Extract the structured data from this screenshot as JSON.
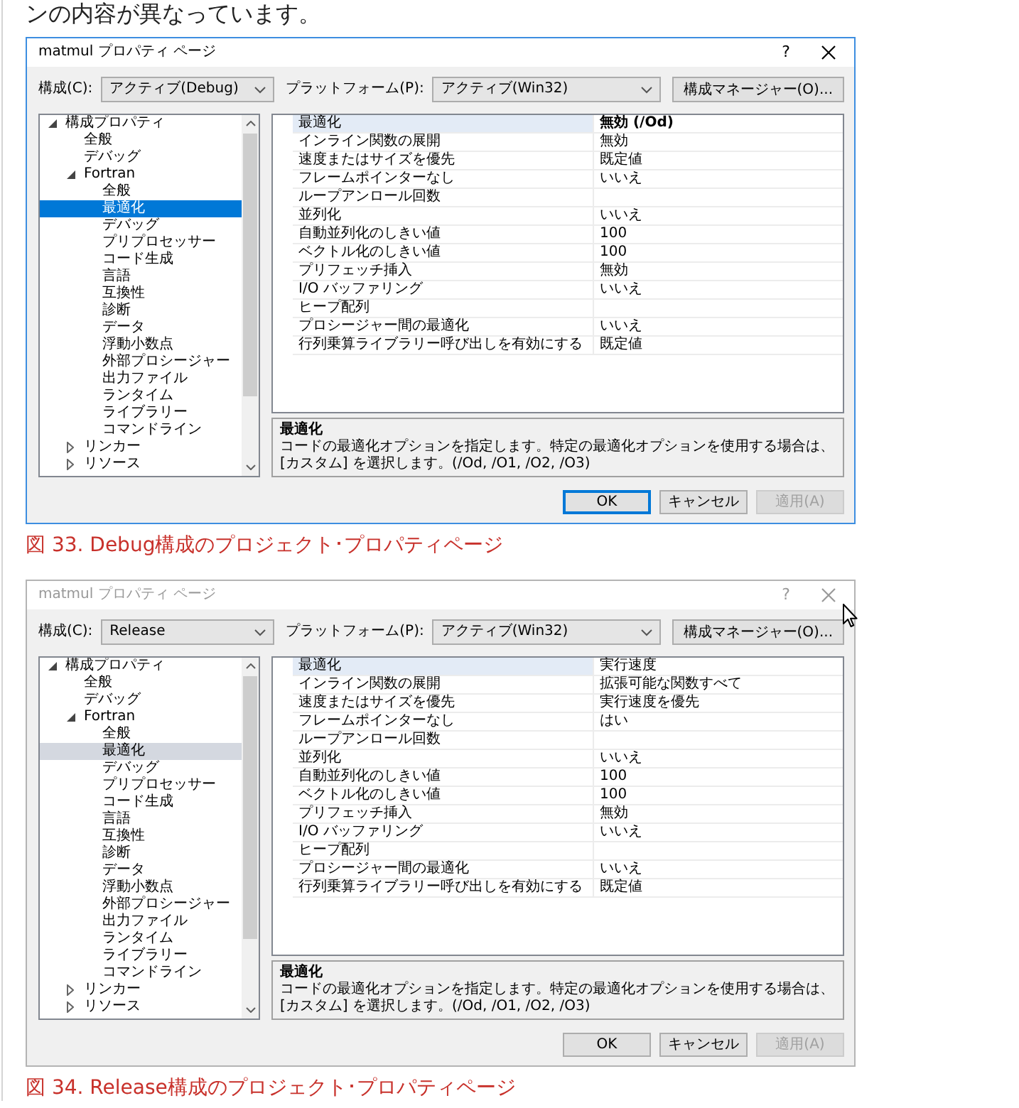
{
  "intro_text": "ンの内容が異なっています。",
  "figures": [
    {
      "dialog": {
        "active": true,
        "title": "matmul プロパティ ページ",
        "help_label": "?",
        "toolbar": {
          "config_label": "構成(C):",
          "config_value": "アクティブ(Debug)",
          "platform_label": "プラットフォーム(P):",
          "platform_value": "アクティブ(Win32)",
          "manager_button": "構成マネージャー(O)..."
        },
        "tree": [
          {
            "label": "構成プロパティ",
            "expanded": true,
            "selected": false,
            "children": [
              {
                "label": "全般",
                "selected": false
              },
              {
                "label": "デバッグ",
                "selected": false
              },
              {
                "label": "Fortran",
                "expanded": true,
                "selected": false,
                "children": [
                  {
                    "label": "全般",
                    "selected": false
                  },
                  {
                    "label": "最適化",
                    "selected": true
                  },
                  {
                    "label": "デバッグ",
                    "selected": false
                  },
                  {
                    "label": "プリプロセッサー",
                    "selected": false
                  },
                  {
                    "label": "コード生成",
                    "selected": false
                  },
                  {
                    "label": "言語",
                    "selected": false
                  },
                  {
                    "label": "互換性",
                    "selected": false
                  },
                  {
                    "label": "診断",
                    "selected": false
                  },
                  {
                    "label": "データ",
                    "selected": false
                  },
                  {
                    "label": "浮動小数点",
                    "selected": false
                  },
                  {
                    "label": "外部プロシージャー",
                    "selected": false
                  },
                  {
                    "label": "出力ファイル",
                    "selected": false
                  },
                  {
                    "label": "ランタイム",
                    "selected": false
                  },
                  {
                    "label": "ライブラリー",
                    "selected": false
                  },
                  {
                    "label": "コマンドライン",
                    "selected": false
                  }
                ]
              },
              {
                "label": "リンカー",
                "expanded": false,
                "selected": false
              },
              {
                "label": "リソース",
                "expanded": false,
                "selected": false
              }
            ]
          }
        ],
        "properties": [
          {
            "name": "最適化",
            "value": "無効 (/Od)",
            "modified": true,
            "selected": true
          },
          {
            "name": "インライン関数の展開",
            "value": "無効",
            "modified": false,
            "selected": false
          },
          {
            "name": "速度またはサイズを優先",
            "value": "既定値",
            "modified": false,
            "selected": false
          },
          {
            "name": "フレームポインターなし",
            "value": "いいえ",
            "modified": false,
            "selected": false
          },
          {
            "name": "ループアンロール回数",
            "selected": false
          },
          {
            "name": "並列化",
            "value": "いいえ",
            "modified": false,
            "selected": false
          },
          {
            "name": "自動並列化のしきい値",
            "value": "100",
            "modified": false,
            "selected": false
          },
          {
            "name": "ベクトル化のしきい値",
            "value": "100",
            "modified": false,
            "selected": false
          },
          {
            "name": "プリフェッチ挿入",
            "value": "無効",
            "modified": false,
            "selected": false
          },
          {
            "name": "I/O バッファリング",
            "value": "いいえ",
            "modified": false,
            "selected": false
          },
          {
            "name": "ヒープ配列",
            "selected": false
          },
          {
            "name": "プロシージャー間の最適化",
            "value": "いいえ",
            "modified": false,
            "selected": false
          },
          {
            "name": "行列乗算ライブラリー呼び出しを有効にする",
            "value": "既定値",
            "modified": false,
            "selected": false
          }
        ],
        "description": {
          "title": "最適化",
          "text": "コードの最適化オプションを指定します。特定の最適化オプションを使用する場合は、[カスタム] を選択します。(/Od, /O1, /O2, /O3)"
        },
        "buttons": [
          {
            "label": "OK",
            "focused": true,
            "disabled": false
          },
          {
            "label": "キャンセル",
            "focused": false,
            "disabled": false
          },
          {
            "label": "適用(A)",
            "focused": false,
            "disabled": true
          }
        ]
      },
      "caption": "図 33. Debug構成のプロジェクト･プロパティページ"
    },
    {
      "dialog": {
        "active": false,
        "mouse_pointer": true,
        "title": "matmul プロパティ ページ",
        "help_label": "?",
        "toolbar": {
          "config_label": "構成(C):",
          "config_value": "Release",
          "platform_label": "プラットフォーム(P):",
          "platform_value": "アクティブ(Win32)",
          "manager_button": "構成マネージャー(O)..."
        },
        "tree": [
          {
            "label": "構成プロパティ",
            "expanded": true,
            "selected": false,
            "children": [
              {
                "label": "全般",
                "selected": false
              },
              {
                "label": "デバッグ",
                "selected": false
              },
              {
                "label": "Fortran",
                "expanded": true,
                "selected": false,
                "children": [
                  {
                    "label": "全般",
                    "selected": false
                  },
                  {
                    "label": "最適化",
                    "selected": true
                  },
                  {
                    "label": "デバッグ",
                    "selected": false
                  },
                  {
                    "label": "プリプロセッサー",
                    "selected": false
                  },
                  {
                    "label": "コード生成",
                    "selected": false
                  },
                  {
                    "label": "言語",
                    "selected": false
                  },
                  {
                    "label": "互換性",
                    "selected": false
                  },
                  {
                    "label": "診断",
                    "selected": false
                  },
                  {
                    "label": "データ",
                    "selected": false
                  },
                  {
                    "label": "浮動小数点",
                    "selected": false
                  },
                  {
                    "label": "外部プロシージャー",
                    "selected": false
                  },
                  {
                    "label": "出力ファイル",
                    "selected": false
                  },
                  {
                    "label": "ランタイム",
                    "selected": false
                  },
                  {
                    "label": "ライブラリー",
                    "selected": false
                  },
                  {
                    "label": "コマンドライン",
                    "selected": false
                  }
                ]
              },
              {
                "label": "リンカー",
                "expanded": false,
                "selected": false
              },
              {
                "label": "リソース",
                "expanded": false,
                "selected": false
              }
            ]
          }
        ],
        "properties": [
          {
            "name": "最適化",
            "value": "実行速度",
            "modified": false,
            "selected": true
          },
          {
            "name": "インライン関数の展開",
            "value": "拡張可能な関数すべて",
            "modified": false,
            "selected": false
          },
          {
            "name": "速度またはサイズを優先",
            "value": "実行速度を優先",
            "modified": false,
            "selected": false
          },
          {
            "name": "フレームポインターなし",
            "value": "はい",
            "modified": false,
            "selected": false
          },
          {
            "name": "ループアンロール回数",
            "selected": false
          },
          {
            "name": "並列化",
            "value": "いいえ",
            "modified": false,
            "selected": false
          },
          {
            "name": "自動並列化のしきい値",
            "value": "100",
            "modified": false,
            "selected": false
          },
          {
            "name": "ベクトル化のしきい値",
            "value": "100",
            "modified": false,
            "selected": false
          },
          {
            "name": "プリフェッチ挿入",
            "value": "無効",
            "modified": false,
            "selected": false
          },
          {
            "name": "I/O バッファリング",
            "value": "いいえ",
            "modified": false,
            "selected": false
          },
          {
            "name": "ヒープ配列",
            "selected": false
          },
          {
            "name": "プロシージャー間の最適化",
            "value": "いいえ",
            "modified": false,
            "selected": false
          },
          {
            "name": "行列乗算ライブラリー呼び出しを有効にする",
            "value": "既定値",
            "modified": false,
            "selected": false
          }
        ],
        "description": {
          "title": "最適化",
          "text": "コードの最適化オプションを指定します。特定の最適化オプションを使用する場合は、[カスタム] を選択します。(/Od, /O1, /O2, /O3)"
        },
        "buttons": [
          {
            "label": "OK",
            "focused": false,
            "disabled": false
          },
          {
            "label": "キャンセル",
            "focused": false,
            "disabled": false
          },
          {
            "label": "適用(A)",
            "focused": false,
            "disabled": true
          }
        ]
      },
      "caption": "図 34. Release構成のプロジェクト･プロパティページ"
    }
  ]
}
